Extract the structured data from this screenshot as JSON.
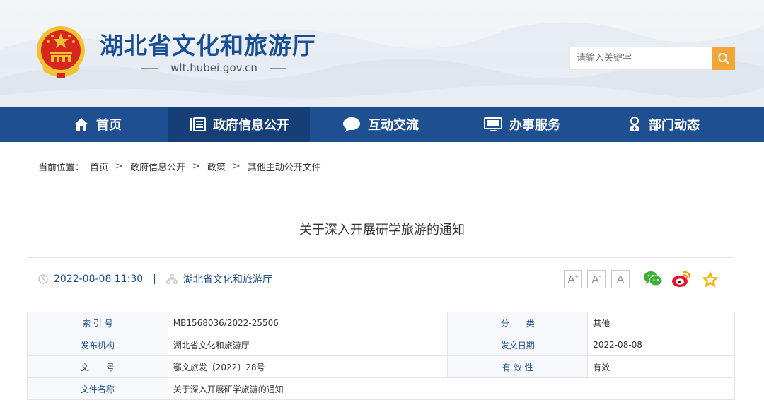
{
  "site": {
    "title": "湖北省文化和旅游厅",
    "domain": "wlt.hubei.gov.cn"
  },
  "search": {
    "placeholder": "请输入关键字"
  },
  "nav": {
    "items": [
      {
        "label": "首页",
        "icon": "home-icon"
      },
      {
        "label": "政府信息公开",
        "icon": "document-list-icon"
      },
      {
        "label": "互动交流",
        "icon": "chat-bubble-icon"
      },
      {
        "label": "办事服务",
        "icon": "monitor-icon"
      },
      {
        "label": "部门动态",
        "icon": "person-badge-icon"
      }
    ],
    "active_index": 1
  },
  "breadcrumb": {
    "prefix": "当前位置：",
    "items": [
      "首页",
      "政府信息公开",
      "政策",
      "其他主动公开文件"
    ],
    "separator": ">"
  },
  "article": {
    "title": "关于深入开展研学旅游的通知",
    "datetime": "2022-08-08 11:30",
    "source": "湖北省文化和旅游厅"
  },
  "toolbar": {
    "font_large": "A",
    "font_medium": "A",
    "font_small": "A"
  },
  "info_table": {
    "index_label": "索 引 号",
    "index_value": "MB1568036/2022-25506",
    "category_label": "分　　类",
    "category_value": "其他",
    "publisher_label": "发布机构",
    "publisher_value": "湖北省文化和旅游厅",
    "date_label": "发文日期",
    "date_value": "2022-08-08",
    "docno_label": "文　　号",
    "docno_value": "鄂文旅发〔2022〕28号",
    "validity_label": "有 效 性",
    "validity_value": "有效",
    "filename_label": "文件名称",
    "filename_value": "关于深入开展研学旅游的通知"
  },
  "colors": {
    "brand_blue": "#1d4f91",
    "nav_active": "#163f77",
    "search_orange": "#f3a535",
    "emblem_red": "#d7261e",
    "emblem_gold": "#f2c230"
  }
}
